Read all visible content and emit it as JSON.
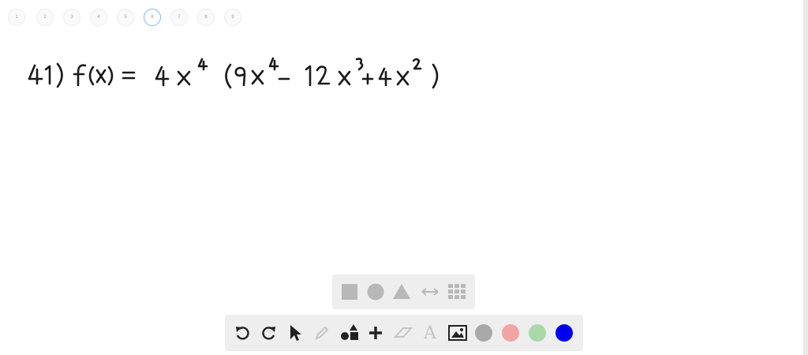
{
  "pages": {
    "items": [
      "1",
      "2",
      "3",
      "4",
      "5",
      "6",
      "7",
      "8",
      "9"
    ],
    "active": "6"
  },
  "canvas": {
    "equation": "41) f(x)= 4x^4 (9x^4 - 12x^3 + 4x^2)"
  },
  "shape_toolbar": {
    "tools": [
      "square-icon",
      "circle-icon",
      "triangle-icon",
      "double-arrow-icon",
      "grid-icon"
    ],
    "color": "#b8b8b8"
  },
  "main_toolbar": {
    "tools": [
      "undo-icon",
      "redo-icon",
      "pointer-icon",
      "pencil-icon",
      "shapes-icon",
      "plus-icon",
      "eraser-icon",
      "text-icon",
      "image-icon"
    ],
    "colors": [
      "#a8a8a8",
      "#f2a3a3",
      "#a9d9a9",
      "#0000ee"
    ],
    "text_tool_glyph": "A"
  }
}
